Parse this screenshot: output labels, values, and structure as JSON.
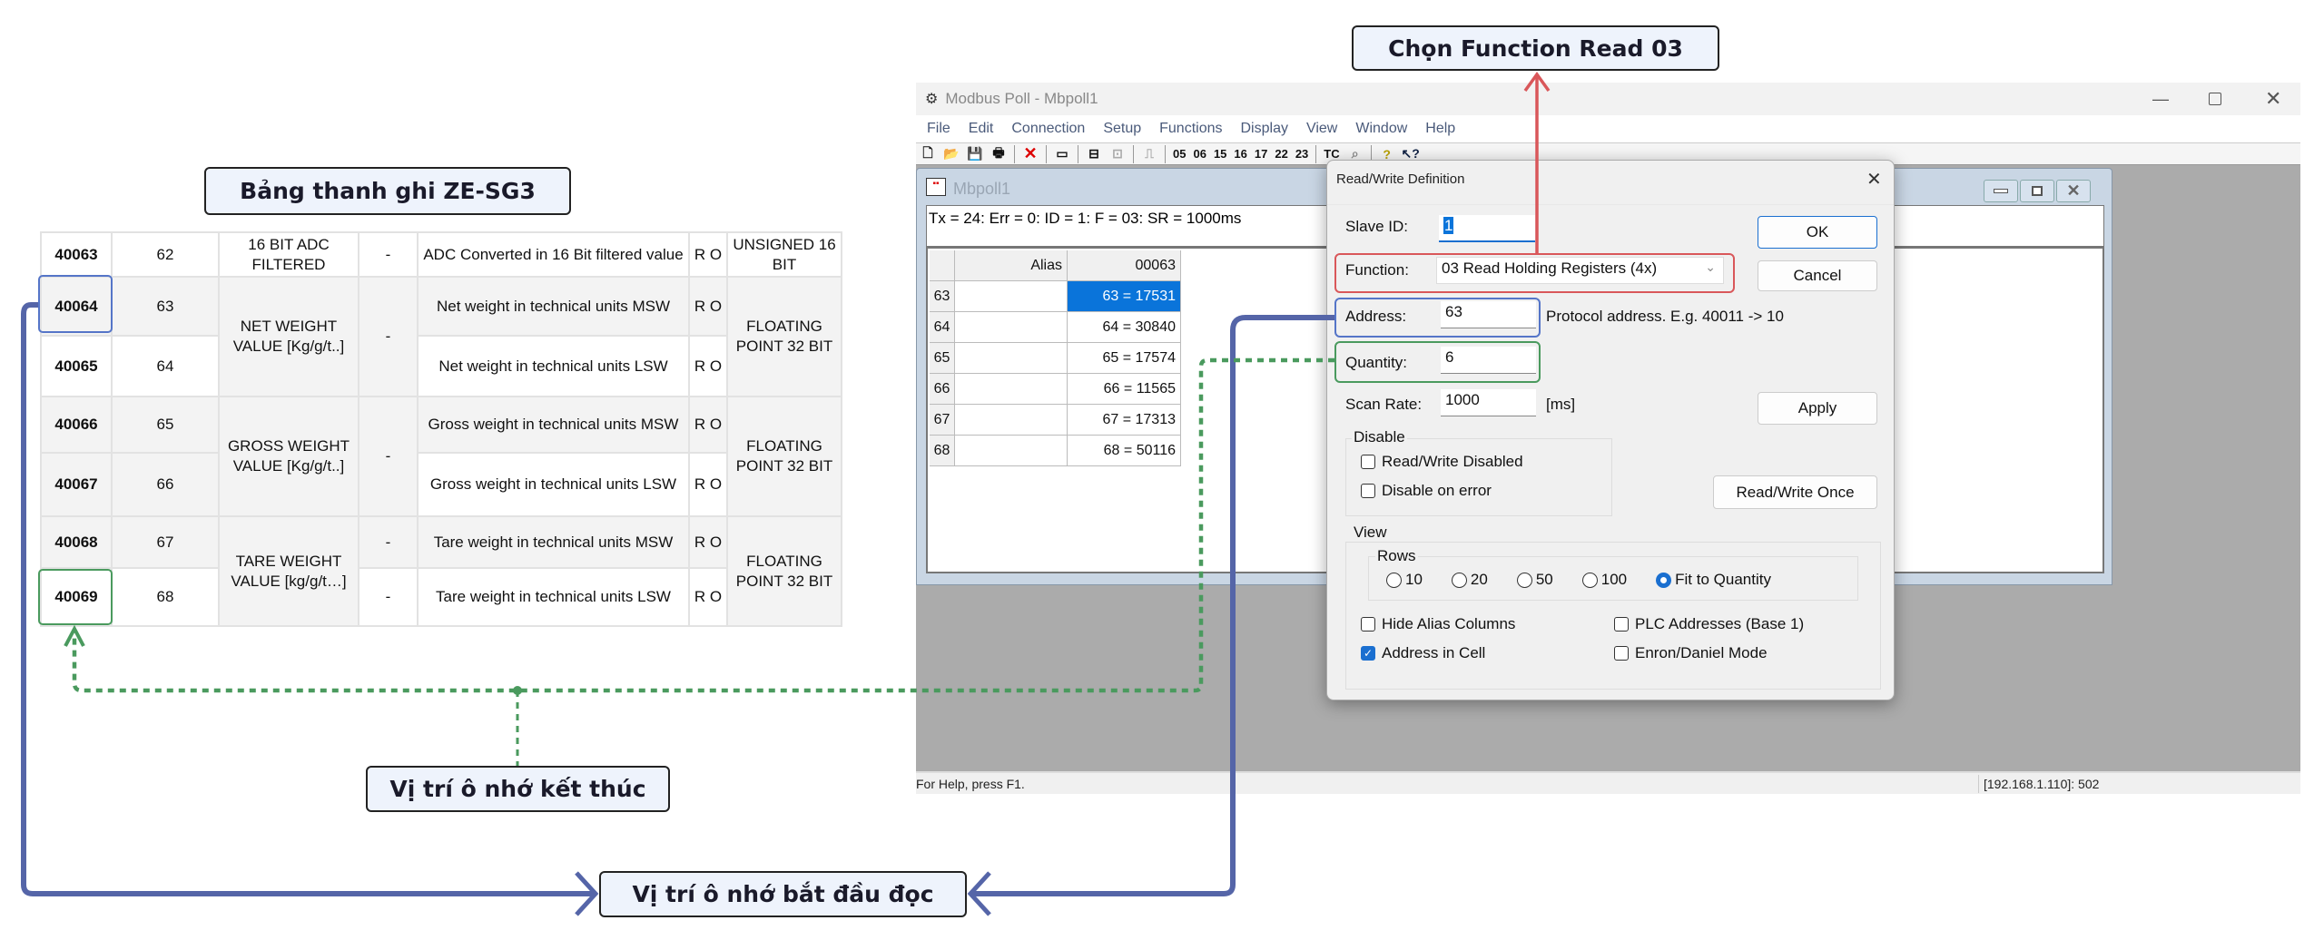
{
  "callouts": {
    "table_title": "Bảng thanh ghi ZE-SG3",
    "function_note": "Chọn Function Read 03",
    "end_note": "Vị trí ô nhớ kết thúc",
    "start_note": "Vị trí ô nhớ bắt đầu đọc"
  },
  "register_table": {
    "groups": [
      {
        "name": "16 BIT ADC FILTERED",
        "units": [
          "-"
        ],
        "type": "UNSIGNED 16 BIT",
        "regs": [
          {
            "addr": "40063",
            "index": "62",
            "desc": "ADC Converted in 16 Bit filtered value",
            "access": "R O"
          }
        ]
      },
      {
        "name": "NET WEIGHT VALUE [Kg/g/t..]",
        "units": [
          "-"
        ],
        "type": "FLOATING POINT 32 BIT",
        "regs": [
          {
            "addr": "40064",
            "index": "63",
            "desc": "Net weight in technical units MSW",
            "access": "R O"
          },
          {
            "addr": "40065",
            "index": "64",
            "desc": "Net weight in technical units LSW",
            "access": "R O"
          }
        ]
      },
      {
        "name": "GROSS WEIGHT VALUE [Kg/g/t..]",
        "units": [
          "-"
        ],
        "type": "FLOATING POINT 32 BIT",
        "regs": [
          {
            "addr": "40066",
            "index": "65",
            "desc": "Gross weight in technical units MSW",
            "access": "R O"
          },
          {
            "addr": "40067",
            "index": "66",
            "desc": "Gross weight in technical units LSW",
            "access": "R O"
          }
        ]
      },
      {
        "name": "TARE WEIGHT VALUE [kg/g/t…]",
        "units": [
          "-",
          "-"
        ],
        "type": "FLOATING POINT 32 BIT",
        "regs": [
          {
            "addr": "40068",
            "index": "67",
            "desc": "Tare weight in technical units MSW",
            "access": "R O"
          },
          {
            "addr": "40069",
            "index": "68",
            "desc": "Tare weight in technical units LSW",
            "access": "R O"
          }
        ]
      }
    ]
  },
  "app": {
    "title": "Modbus Poll - Mbpoll1",
    "menu": [
      "File",
      "Edit",
      "Connection",
      "Setup",
      "Functions",
      "Display",
      "View",
      "Window",
      "Help"
    ],
    "toolbar_codes": [
      "05",
      "06",
      "15",
      "16",
      "17",
      "22",
      "23"
    ],
    "toolbar_tc": "TC",
    "status_left": "For Help, press F1.",
    "status_right": "[192.168.1.110]: 502"
  },
  "child": {
    "title": "Mbpoll1",
    "status_line": "Tx = 24: Err = 0: ID = 1: F = 03: SR = 1000ms",
    "columns": [
      "Alias",
      "00063"
    ],
    "rows": [
      {
        "num": "63",
        "alias": "",
        "value": "63 = 17531",
        "selected": true
      },
      {
        "num": "64",
        "alias": "",
        "value": "64 = 30840"
      },
      {
        "num": "65",
        "alias": "",
        "value": "65 = 17574"
      },
      {
        "num": "66",
        "alias": "",
        "value": "66 = 11565"
      },
      {
        "num": "67",
        "alias": "",
        "value": "67 = 17313"
      },
      {
        "num": "68",
        "alias": "",
        "value": "68 = 50116"
      }
    ]
  },
  "dialog": {
    "title": "Read/Write Definition",
    "slave_id_label": "Slave ID:",
    "slave_id": "1",
    "function_label": "Function:",
    "function_value": "03 Read Holding Registers (4x)",
    "address_label": "Address:",
    "address": "63",
    "address_hint": "Protocol address. E.g. 40011 -> 10",
    "quantity_label": "Quantity:",
    "quantity": "6",
    "scan_rate_label": "Scan Rate:",
    "scan_rate": "1000",
    "scan_rate_unit": "[ms]",
    "ok": "OK",
    "cancel": "Cancel",
    "apply": "Apply",
    "rw_once": "Read/Write Once",
    "disable_group": "Disable",
    "rw_disabled": "Read/Write Disabled",
    "disable_on_error": "Disable on error",
    "view_group": "View",
    "rows_group": "Rows",
    "rows_options": [
      "10",
      "20",
      "50",
      "100",
      "Fit to Quantity"
    ],
    "rows_selected": "Fit to Quantity",
    "hide_alias": "Hide Alias Columns",
    "address_in_cell": "Address in Cell",
    "plc_addresses": "PLC Addresses (Base 1)",
    "enron": "Enron/Daniel Mode",
    "checked": {
      "rw_disabled": false,
      "disable_on_error": false,
      "hide_alias": false,
      "address_in_cell": true,
      "plc_addresses": false,
      "enron": false
    }
  },
  "colors": {
    "start_line": "#5565a8",
    "end_line": "#4a9a5e",
    "function_line": "#d9575a",
    "selection": "#0a74da"
  }
}
